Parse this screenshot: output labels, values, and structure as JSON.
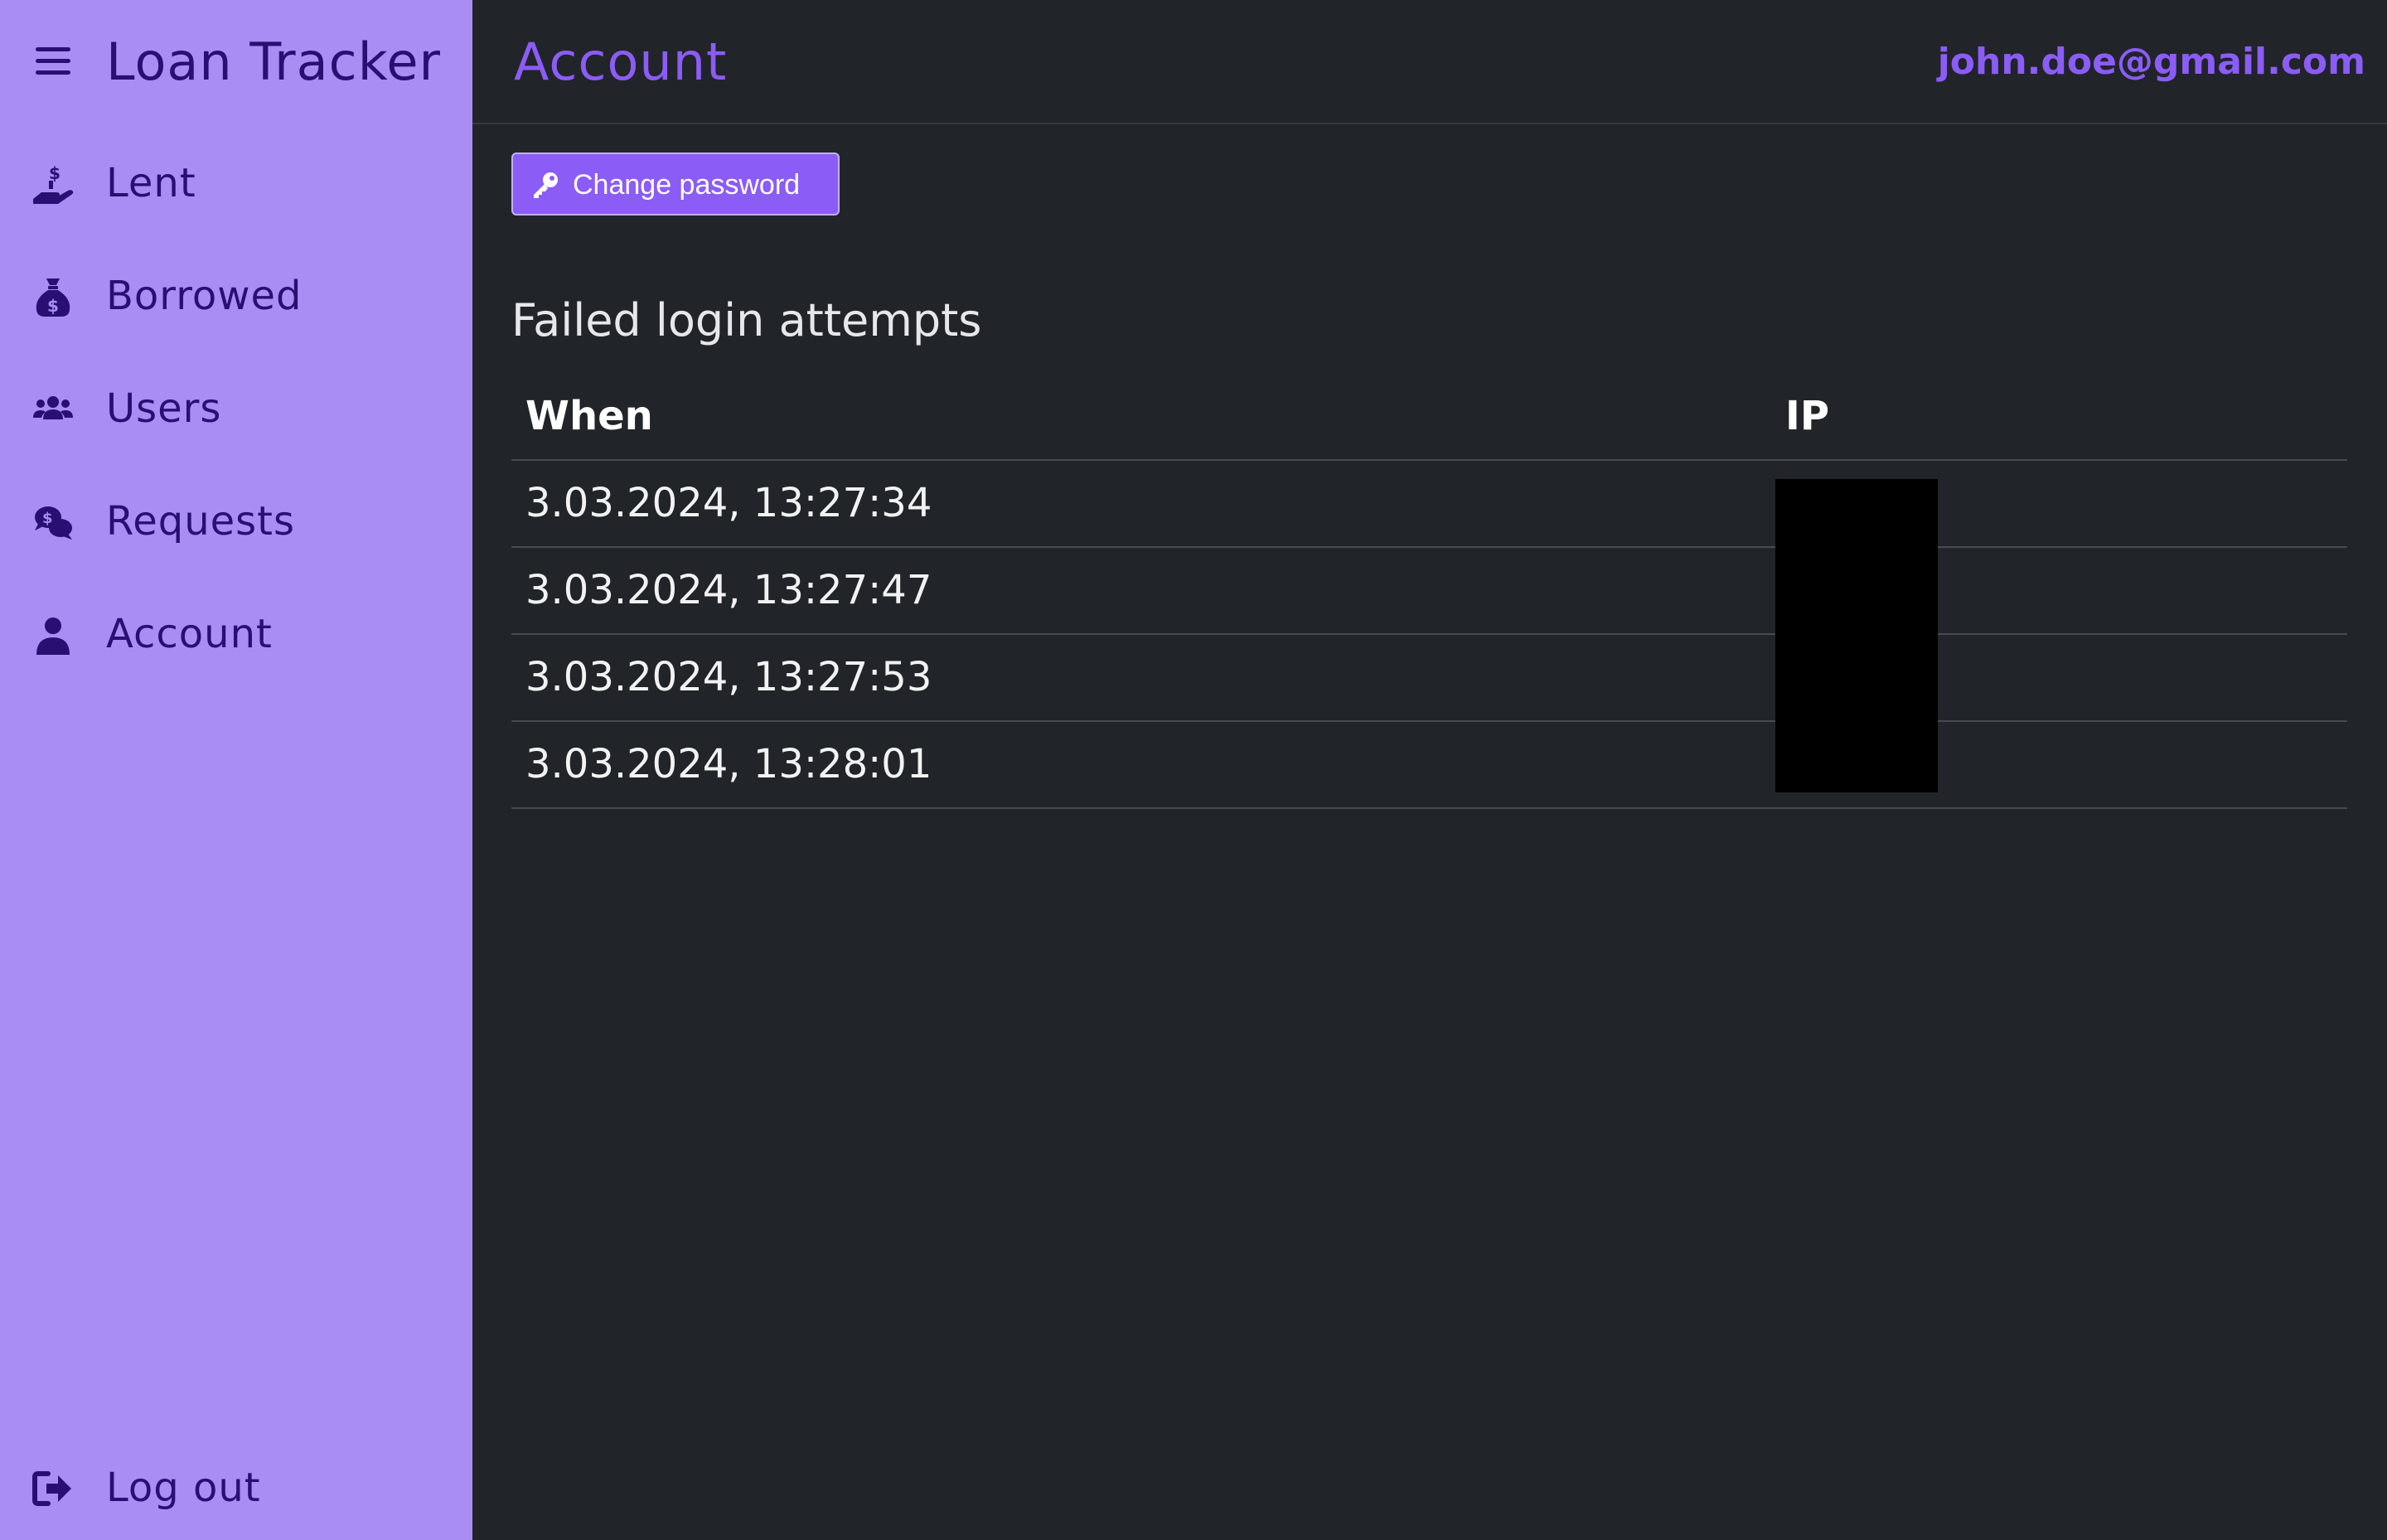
{
  "sidebar": {
    "brand_title": "Loan Tracker",
    "items": [
      {
        "label": "Lent",
        "icon": "hand-holding-dollar-icon"
      },
      {
        "label": "Borrowed",
        "icon": "money-bag-icon"
      },
      {
        "label": "Users",
        "icon": "users-icon"
      },
      {
        "label": "Requests",
        "icon": "comments-dollar-icon"
      },
      {
        "label": "Account",
        "icon": "user-icon"
      }
    ],
    "logout_label": "Log out",
    "logout_icon": "sign-out-icon",
    "menu_icon": "hamburger-menu-icon"
  },
  "header": {
    "title": "Account",
    "user_email": "john.doe@gmail.com"
  },
  "actions": {
    "change_password_label": "Change password",
    "change_password_icon": "key-icon"
  },
  "failed_logins": {
    "title": "Failed login attempts",
    "columns": [
      "When",
      "IP"
    ],
    "rows": [
      {
        "when": "3.03.2024, 13:27:34"
      },
      {
        "when": "3.03.2024, 13:27:47"
      },
      {
        "when": "3.03.2024, 13:27:53"
      },
      {
        "when": "3.03.2024, 13:28:01"
      }
    ]
  },
  "colors": {
    "sidebar_bg": "#a98cf4",
    "sidebar_text": "#2a0f73",
    "main_bg": "#212429",
    "accent": "#8b5cf6"
  }
}
